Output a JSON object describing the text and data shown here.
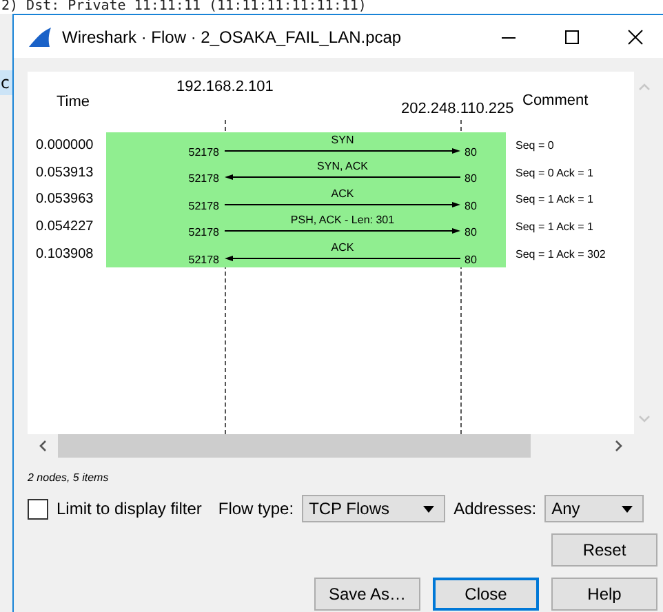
{
  "background": {
    "packet_detail": "2)  Dst: Private 11:11:11 (11:11:11:11:11:11)",
    "fragment": "c"
  },
  "window": {
    "title": "Wireshark · Flow · 2_OSAKA_FAIL_LAN.pcap"
  },
  "graph": {
    "time_header": "Time",
    "comment_header": "Comment",
    "nodes": [
      "192.168.2.101",
      "202.248.110.225"
    ],
    "rows": [
      {
        "time": "0.000000",
        "src_port": "52178",
        "label": "SYN",
        "dst_port": "80",
        "kind": "right",
        "comment": "Seq = 0"
      },
      {
        "time": "0.053913",
        "src_port": "52178",
        "label": "SYN, ACK",
        "dst_port": "80",
        "kind": "left",
        "comment": "Seq = 0 Ack = 1"
      },
      {
        "time": "0.053963",
        "src_port": "52178",
        "label": "ACK",
        "dst_port": "80",
        "kind": "right",
        "comment": "Seq = 1 Ack = 1"
      },
      {
        "time": "0.054227",
        "src_port": "52178",
        "label": "PSH, ACK - Len: 301",
        "dst_port": "80",
        "kind": "right",
        "comment": "Seq = 1 Ack = 1"
      },
      {
        "time": "0.103908",
        "src_port": "52178",
        "label": "ACK",
        "dst_port": "80",
        "kind": "left",
        "comment": "Seq = 1 Ack = 302"
      }
    ]
  },
  "status": "2 nodes, 5 items",
  "limit_to_display_filter": {
    "label": "Limit to display filter",
    "checked": false
  },
  "flow_type": {
    "label": "Flow type:",
    "value": "TCP Flows"
  },
  "addresses": {
    "label": "Addresses:",
    "value": "Any"
  },
  "buttons": {
    "reset": "Reset",
    "save_as": "Save As…",
    "close": "Close",
    "help": "Help"
  }
}
